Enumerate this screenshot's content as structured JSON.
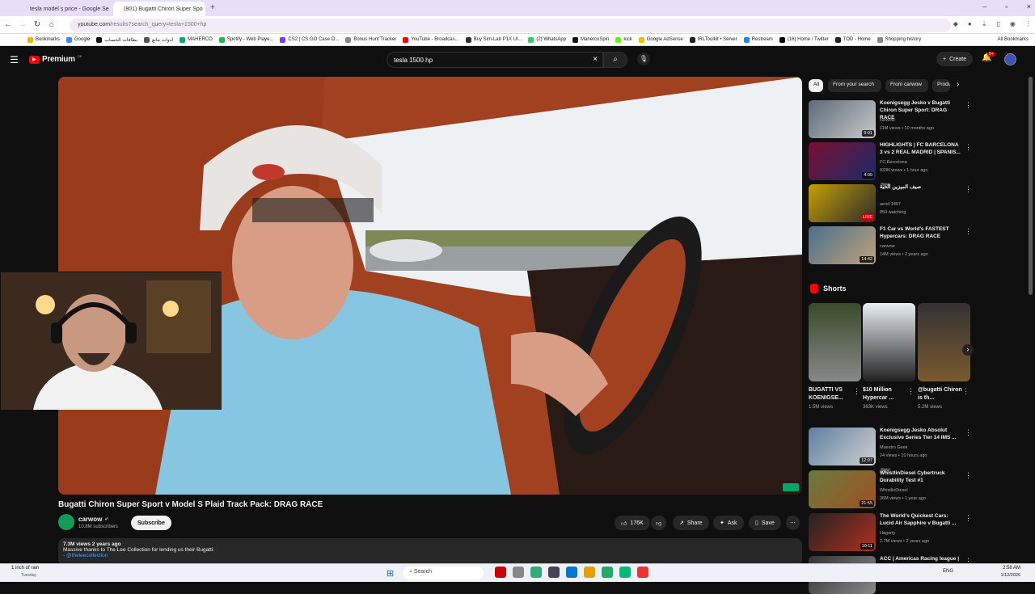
{
  "browser": {
    "tabs": [
      {
        "title": "tesla model s price - Google Se"
      },
      {
        "title": "(801) Bugatti Chiron Super Spo"
      }
    ],
    "url_host": "youtube.com",
    "url_path": "/results?search_query=tesla+1500+hp",
    "bookmarks": [
      "Bookmarks",
      "Google",
      "بطاقات الحساب",
      "ادوات مانع",
      "MAHERCO",
      "Spotify - Web Playe...",
      "CS2 | CS:GO Case O...",
      "Bonus Hunt Tracker",
      "YouTube - Broadcas...",
      "Buy Sim-Lab P1X Ul...",
      "(2) WhatsApp",
      "MahercoSpin",
      "kick",
      "Google AdSense",
      "IRLToolkit • Server",
      "Restream",
      "(16) Home / Twitter",
      "TOD - Home",
      "Shopping history"
    ],
    "all_bookmarks": "All Bookmarks"
  },
  "youtube": {
    "logo": "Premium",
    "logo_sup": "DE",
    "search_value": "tesla 1500 hp",
    "create_label": "Create",
    "notif_count": "9+"
  },
  "video": {
    "title": "Bugatti Chiron Super Sport v Model S Plaid Track Pack: DRAG RACE",
    "channel": "carwow",
    "subscribers": "10.8M subscribers",
    "subscribe_label": "Subscribe",
    "likes": "176K",
    "share_label": "Share",
    "ask_label": "Ask",
    "save_label": "Save",
    "views_time": "7.3M views  2 years ago",
    "description": "Massive thanks to The Lee Collection for lending us their Bugatti:",
    "desc_link": "- @theleecollection"
  },
  "sidebar": {
    "chips": [
      "All",
      "From your search",
      "From carwow",
      "Produ"
    ],
    "recs_top": [
      {
        "title": "Koenigsegg Jesko v Bugatti Chiron Super Sport: DRAG RACE",
        "channel": "carwow",
        "stats": "11M views • 10 months ago",
        "duration": "9:01",
        "new": ""
      },
      {
        "title": "HIGHLIGHTS | FC BARCELONA 3 vs 2 REAL MADRID | SPANIS...",
        "channel": "FC Barcelona",
        "stats": "933K views • 1 hour ago",
        "duration": "4:09",
        "new": "New"
      },
      {
        "title": "صيف الميزين الحية",
        "channel": "aeod 1407",
        "stats": "859 watching",
        "duration": "LIVE",
        "new": ""
      },
      {
        "title": "F1 Car vs World's FASTEST Hypercars: DRAG RACE",
        "channel": "carwow",
        "stats": "14M views • 2 years ago",
        "duration": "14:42",
        "new": ""
      }
    ],
    "shorts_label": "Shorts",
    "shorts": [
      {
        "title": "BUGATTI VS KOENIGSE...",
        "views": "1.5M views"
      },
      {
        "title": "$10 Million Hypercar ...",
        "views": "363K views"
      },
      {
        "title": "@bugatti Chiron is th...",
        "views": "5.2M views"
      }
    ],
    "recs_bottom": [
      {
        "title": "Koenigsegg Jesko Absolut Exclusive Series Tier 14 IMS ...",
        "channel": "Maestro Geek",
        "stats": "24 views • 10 hours ago",
        "duration": "12:07",
        "new": "New"
      },
      {
        "title": "WhistlinDiesel Cybertruck Durability Test #1",
        "channel": "WhistlinDiesel",
        "stats": "36M views • 1 year ago",
        "duration": "21:55",
        "new": ""
      },
      {
        "title": "The World's Quickest Cars: Lucid Air Sapphire v Bugatti ...",
        "channel": "Hagerty",
        "stats": "2.7M views • 2 years ago",
        "duration": "10:11",
        "new": ""
      },
      {
        "title": "ACC | Americas Racing league |",
        "channel": "",
        "stats": "",
        "duration": "",
        "new": ""
      }
    ]
  },
  "taskbar": {
    "weather": "1 inch of rain",
    "weather_sub": "Tuesday",
    "search": "Search",
    "lang": "ENG",
    "time": "2:58 AM",
    "date": "1/12/2026"
  },
  "colors": {
    "yt_red": "#ff0000",
    "bg": "#0f0f0f",
    "chip": "#272727"
  }
}
